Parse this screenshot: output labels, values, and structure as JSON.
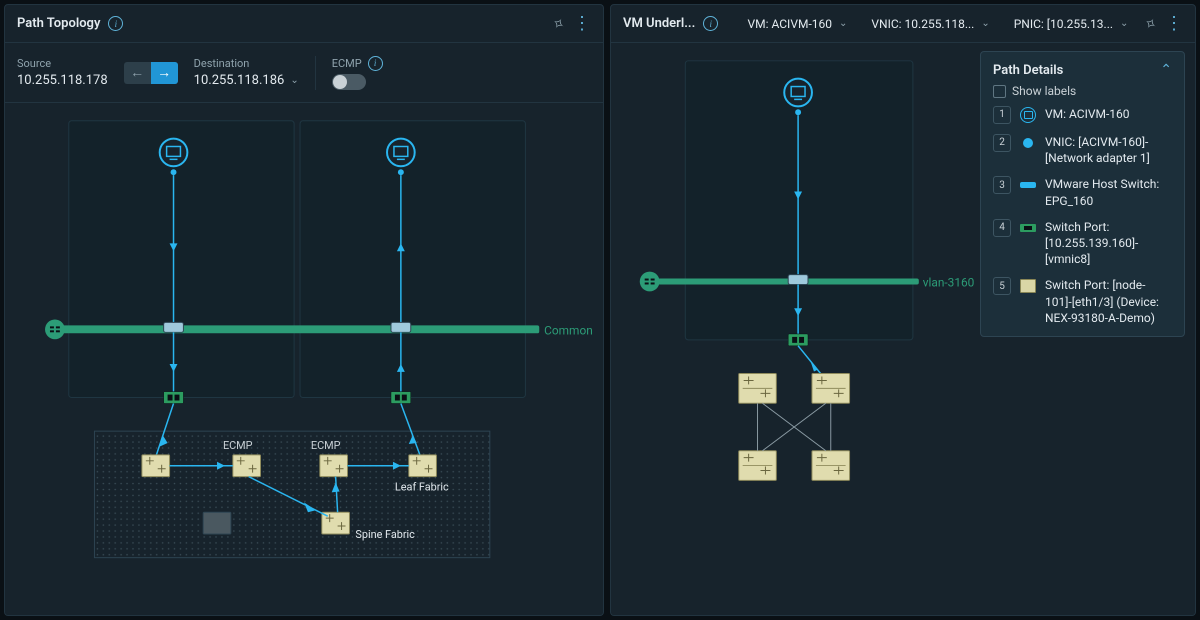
{
  "left": {
    "title": "Path Topology",
    "source_label": "Source",
    "source_value": "10.255.118.178",
    "dest_label": "Destination",
    "dest_value": "10.255.118.186",
    "ecmp_label": "ECMP",
    "band_label": "Common",
    "ecmp1": "ECMP",
    "ecmp2": "ECMP",
    "leaf_fabric": "Leaf Fabric",
    "spine_fabric": "Spine Fabric"
  },
  "right": {
    "title": "VM Underl...",
    "vm_pill": "VM: ACIVM-160",
    "vnic_pill": "VNIC: 10.255.118...",
    "pnic_pill": "PNIC: [10.255.13...",
    "band_label": "vlan-3160",
    "details": {
      "title": "Path Details",
      "show_labels": "Show labels",
      "steps": [
        {
          "n": "1",
          "text": "VM: ACIVM-160"
        },
        {
          "n": "2",
          "text": "VNIC: [ACIVM-160]-[Network adapter 1]"
        },
        {
          "n": "3",
          "text": "VMware Host Switch: EPG_160"
        },
        {
          "n": "4",
          "text": "Switch Port: [10.255.139.160]-[vmnic8]"
        },
        {
          "n": "5",
          "text": "Switch Port: [node-101]-[eth1/3] (Device: NEX-93180-A-Demo)"
        }
      ]
    }
  }
}
